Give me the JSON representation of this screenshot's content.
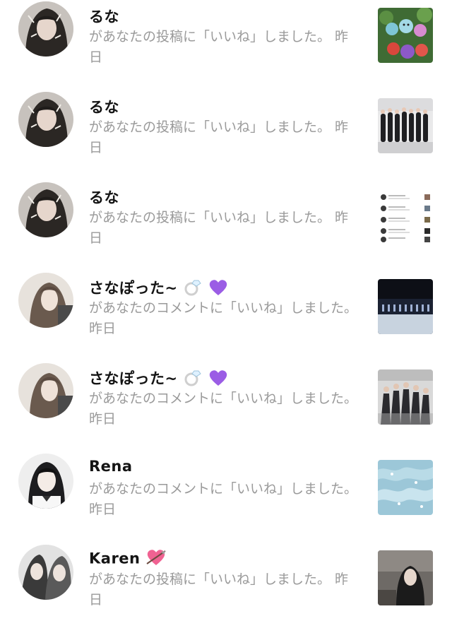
{
  "notifications": [
    {
      "username": "るな",
      "message_line1": "があなたの投稿に「いいね」しました。 昨",
      "message_line2": "日",
      "avatar_icon": "user-avatar-photo",
      "thumbnail_icon": "plush-toys-photo"
    },
    {
      "username": "るな",
      "message_line1": "があなたの投稿に「いいね」しました。 昨",
      "message_line2": "日",
      "avatar_icon": "user-avatar-photo",
      "thumbnail_icon": "group-photo"
    },
    {
      "username": "るな",
      "message_line1": "があなたの投稿に「いいね」しました。 昨",
      "message_line2": "日",
      "avatar_icon": "user-avatar-photo",
      "thumbnail_icon": "screenshot-thumbnail"
    },
    {
      "username": "さなぽった~",
      "message_line1": "があなたのコメントに「いいね」しました。",
      "message_line2": "昨日",
      "avatar_icon": "user-avatar-photo",
      "thumbnail_icon": "concert-stage-photo"
    },
    {
      "username": "さなぽった~",
      "message_line1": "があなたのコメントに「いいね」しました。",
      "message_line2": "昨日",
      "avatar_icon": "user-avatar-photo",
      "thumbnail_icon": "group-dance-photo"
    },
    {
      "username": "Rena",
      "message_line1": "があなたのコメントに「いいね」しました。",
      "message_line2": "昨日",
      "avatar_icon": "user-avatar-photo",
      "thumbnail_icon": "water-photo"
    },
    {
      "username": "Karen",
      "message_line1": "があなたの投稿に「いいね」しました。 昨",
      "message_line2": "日",
      "avatar_icon": "user-avatar-photo",
      "thumbnail_icon": "portrait-photo"
    }
  ],
  "colors": {
    "username": "#141414",
    "message": "#9a9a9a",
    "background": "#ffffff",
    "ring_emoji": "#e6e6e6",
    "purple_heart": "#9b5de5",
    "arrow_heart": "#f06292"
  }
}
